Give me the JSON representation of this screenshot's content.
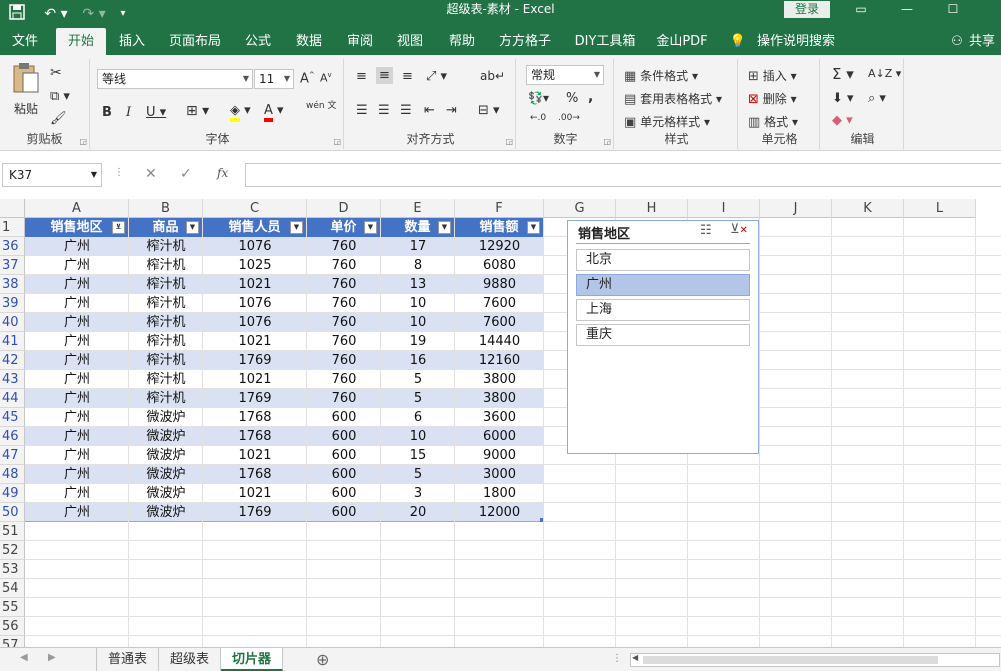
{
  "titlebar": {
    "title": "超级表-素材  -  Excel",
    "login": "登录",
    "save_icon": "save-icon",
    "undo_icon": "undo-icon",
    "redo_icon": "redo-icon",
    "customize_icon": "customize-icon",
    "win_ribbon_opts": "ribbon-display-icon",
    "win_min": "minimize-icon",
    "win_max": "maximize-icon",
    "win_close": "close-icon"
  },
  "tabs": [
    "文件",
    "开始",
    "插入",
    "页面布局",
    "公式",
    "数据",
    "审阅",
    "视图",
    "帮助",
    "方方格子",
    "DIY工具箱",
    "金山PDF",
    "操作说明搜索"
  ],
  "share_label": "共享",
  "ribbon": {
    "clipboard": {
      "label": "剪贴板",
      "paste": "粘贴"
    },
    "font": {
      "label": "字体",
      "font_name": "等线",
      "font_size": "11",
      "wen_label": "wén 文"
    },
    "align": {
      "label": "对齐方式"
    },
    "number": {
      "label": "数字",
      "format": "常规"
    },
    "styles": {
      "label": "样式",
      "cond": "条件格式",
      "table": "套用表格格式",
      "cell": "单元格样式"
    },
    "cells": {
      "label": "单元格",
      "insert": "插入",
      "delete": "删除",
      "format": "格式"
    },
    "editing": {
      "label": "编辑"
    }
  },
  "formula_bar": {
    "name_box": "K37",
    "fx": "fx",
    "value": ""
  },
  "columns": [
    "A",
    "B",
    "C",
    "D",
    "E",
    "F",
    "G",
    "H",
    "I",
    "J",
    "K",
    "L"
  ],
  "header_row": "1",
  "table": {
    "headers": [
      "销售地区",
      "商品",
      "销售人员",
      "单价",
      "数量",
      "销售额"
    ],
    "rows": [
      {
        "n": "36",
        "c": [
          "广州",
          "榨汁机",
          "1076",
          "760",
          "17",
          "12920"
        ]
      },
      {
        "n": "37",
        "c": [
          "广州",
          "榨汁机",
          "1025",
          "760",
          "8",
          "6080"
        ]
      },
      {
        "n": "38",
        "c": [
          "广州",
          "榨汁机",
          "1021",
          "760",
          "13",
          "9880"
        ]
      },
      {
        "n": "39",
        "c": [
          "广州",
          "榨汁机",
          "1076",
          "760",
          "10",
          "7600"
        ]
      },
      {
        "n": "40",
        "c": [
          "广州",
          "榨汁机",
          "1076",
          "760",
          "10",
          "7600"
        ]
      },
      {
        "n": "41",
        "c": [
          "广州",
          "榨汁机",
          "1021",
          "760",
          "19",
          "14440"
        ]
      },
      {
        "n": "42",
        "c": [
          "广州",
          "榨汁机",
          "1769",
          "760",
          "16",
          "12160"
        ]
      },
      {
        "n": "43",
        "c": [
          "广州",
          "榨汁机",
          "1021",
          "760",
          "5",
          "3800"
        ]
      },
      {
        "n": "44",
        "c": [
          "广州",
          "榨汁机",
          "1769",
          "760",
          "5",
          "3800"
        ]
      },
      {
        "n": "45",
        "c": [
          "广州",
          "微波炉",
          "1768",
          "600",
          "6",
          "3600"
        ]
      },
      {
        "n": "46",
        "c": [
          "广州",
          "微波炉",
          "1768",
          "600",
          "10",
          "6000"
        ]
      },
      {
        "n": "47",
        "c": [
          "广州",
          "微波炉",
          "1021",
          "600",
          "15",
          "9000"
        ]
      },
      {
        "n": "48",
        "c": [
          "广州",
          "微波炉",
          "1768",
          "600",
          "5",
          "3000"
        ]
      },
      {
        "n": "49",
        "c": [
          "广州",
          "微波炉",
          "1021",
          "600",
          "3",
          "1800"
        ]
      },
      {
        "n": "50",
        "c": [
          "广州",
          "微波炉",
          "1769",
          "600",
          "20",
          "12000"
        ]
      }
    ],
    "empty_rows": [
      "51",
      "52",
      "53",
      "54",
      "55",
      "56",
      "57"
    ]
  },
  "slicer": {
    "title": "销售地区",
    "items": [
      {
        "label": "北京",
        "selected": false
      },
      {
        "label": "广州",
        "selected": true
      },
      {
        "label": "上海",
        "selected": false
      },
      {
        "label": "重庆",
        "selected": false
      }
    ]
  },
  "sheets": [
    {
      "label": "普通表",
      "active": false
    },
    {
      "label": "超级表",
      "active": false
    },
    {
      "label": "切片器",
      "active": true
    }
  ],
  "colors": {
    "excel_green": "#217346",
    "table_header": "#4472c4",
    "band": "#d9e1f2",
    "slicer_selected": "#b4c6e7"
  }
}
